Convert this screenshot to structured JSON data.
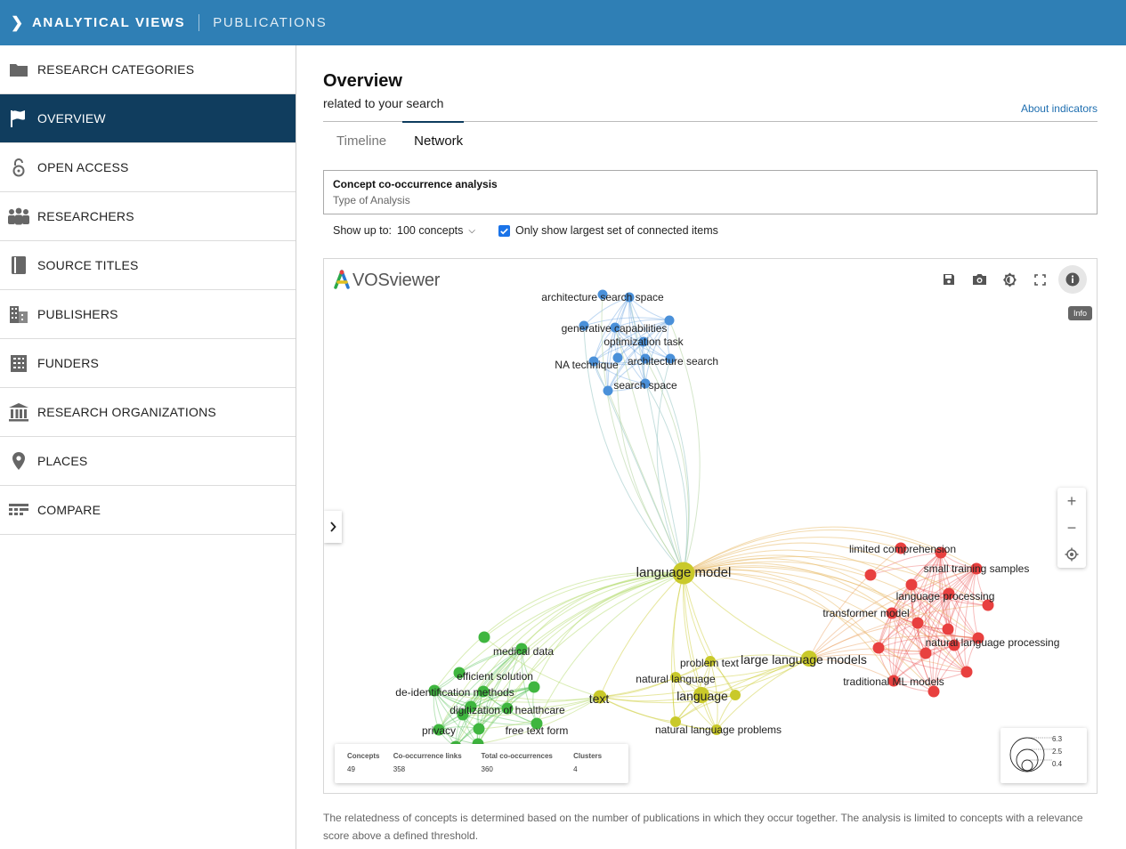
{
  "header": {
    "title": "ANALYTICAL VIEWS",
    "subtitle": "PUBLICATIONS"
  },
  "sidebar": {
    "items": [
      {
        "label": "RESEARCH CATEGORIES",
        "icon": "folder-icon"
      },
      {
        "label": "OVERVIEW",
        "icon": "flag-icon",
        "active": true
      },
      {
        "label": "OPEN ACCESS",
        "icon": "lock-open-icon"
      },
      {
        "label": "RESEARCHERS",
        "icon": "people-icon"
      },
      {
        "label": "SOURCE TITLES",
        "icon": "book-icon"
      },
      {
        "label": "PUBLISHERS",
        "icon": "publisher-building-icon"
      },
      {
        "label": "FUNDERS",
        "icon": "funder-building-icon"
      },
      {
        "label": "RESEARCH ORGANIZATIONS",
        "icon": "institution-icon"
      },
      {
        "label": "PLACES",
        "icon": "location-pin-icon"
      },
      {
        "label": "COMPARE",
        "icon": "compare-icon"
      }
    ]
  },
  "main": {
    "title": "Overview",
    "subtitle": "related to your search",
    "about_link": "About indicators",
    "tabs": [
      {
        "label": "Timeline"
      },
      {
        "label": "Network",
        "active": true
      }
    ],
    "analysis": {
      "value": "Concept co-occurrence analysis",
      "label": "Type of Analysis"
    },
    "show_up_to_label": "Show up to:",
    "show_up_to_value": "100 concepts",
    "connected_only": {
      "label": "Only show largest set of connected items",
      "checked": true
    },
    "footnote": "The relatedness of concepts is determined based on the number of publications in which they occur together. The analysis is limited to concepts with a relevance score above a defined threshold."
  },
  "network": {
    "logo_text": "VOSviewer",
    "toolbar_tooltip": "Info",
    "colors": {
      "blue": "#4a90d9",
      "yellow": "#c9c92a",
      "green": "#3fb63f",
      "red": "#e8403f"
    },
    "stats": [
      {
        "key": "Concepts",
        "value": "49"
      },
      {
        "key": "Co-occurrence links",
        "value": "358"
      },
      {
        "key": "Total co-occurrences",
        "value": "360"
      },
      {
        "key": "Clusters",
        "value": "4"
      }
    ],
    "legend": [
      "6.3",
      "2.5",
      "0.4"
    ],
    "labels": {
      "blue": [
        "architecture search space",
        "generative capabilities",
        "optimization task",
        "NA technique",
        "architecture search",
        "search space"
      ],
      "yellow": [
        "language model",
        "problem text",
        "large language models",
        "natural language",
        "language",
        "text",
        "natural language problems"
      ],
      "green": [
        "medical data",
        "efficient solution",
        "de-identification methods",
        "digitization of healthcare",
        "privacy",
        "free text form"
      ],
      "red": [
        "limited comprehension",
        "small training samples",
        "language processing",
        "transformer model",
        "natural language processing",
        "traditional ML models"
      ]
    }
  }
}
